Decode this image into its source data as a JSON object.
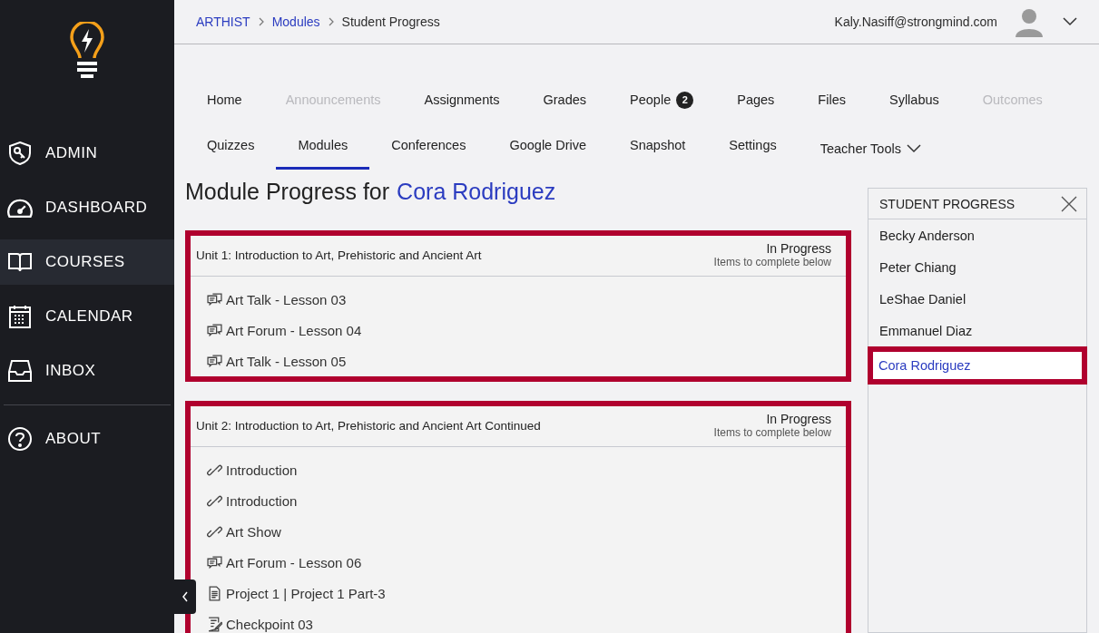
{
  "sidebar": {
    "items": [
      {
        "label": "ADMIN",
        "kind": "admin",
        "selected": false
      },
      {
        "label": "DASHBOARD",
        "kind": "dashboard",
        "selected": false
      },
      {
        "label": "COURSES",
        "kind": "courses",
        "selected": true
      },
      {
        "label": "CALENDAR",
        "kind": "calendar",
        "selected": false
      },
      {
        "label": "INBOX",
        "kind": "inbox",
        "selected": false
      }
    ],
    "footer_items": [
      {
        "label": "ABOUT",
        "kind": "about",
        "selected": false
      }
    ]
  },
  "breadcrumb": [
    {
      "label": "ARTHIST",
      "kind": "link"
    },
    {
      "label": "Modules",
      "kind": "link"
    },
    {
      "label": "Student Progress",
      "kind": "current"
    }
  ],
  "user": {
    "email": "Kaly.Nasiff@strongmind.com"
  },
  "tabs": [
    [
      {
        "label": "Home",
        "selected": false,
        "disabled": false
      },
      {
        "label": "Announcements",
        "selected": false,
        "disabled": true
      },
      {
        "label": "Assignments",
        "selected": false,
        "disabled": false
      },
      {
        "label": "Grades",
        "selected": false,
        "disabled": false
      },
      {
        "label": "People",
        "selected": false,
        "disabled": false,
        "badge": "2"
      },
      {
        "label": "Pages",
        "selected": false,
        "disabled": false
      },
      {
        "label": "Files",
        "selected": false,
        "disabled": false
      },
      {
        "label": "Syllabus",
        "selected": false,
        "disabled": false
      },
      {
        "label": "Outcomes",
        "selected": false,
        "disabled": true
      }
    ],
    [
      {
        "label": "Quizzes",
        "selected": false,
        "disabled": false
      },
      {
        "label": "Modules",
        "selected": true,
        "disabled": false
      },
      {
        "label": "Conferences",
        "selected": false,
        "disabled": false
      },
      {
        "label": "Google Drive",
        "selected": false,
        "disabled": false
      },
      {
        "label": "Snapshot",
        "selected": false,
        "disabled": false
      },
      {
        "label": "Settings",
        "selected": false,
        "disabled": false
      },
      {
        "label": "Teacher Tools",
        "selected": false,
        "disabled": false,
        "kind": "dropdown"
      }
    ]
  ],
  "page_title": {
    "prefix": "Module Progress for",
    "student": "Cora Rodriguez"
  },
  "modules": [
    {
      "title": "Unit 1: Introduction to Art, Prehistoric and Ancient Art",
      "status": "In Progress",
      "status_note": "Items to complete below",
      "highlighted": true,
      "items": [
        {
          "label": "Art Talk - Lesson 03",
          "kind": "discussion"
        },
        {
          "label": "Art Forum - Lesson 04",
          "kind": "discussion"
        },
        {
          "label": "Art Talk - Lesson 05",
          "kind": "discussion"
        }
      ]
    },
    {
      "title": "Unit 2: Introduction to Art, Prehistoric and Ancient Art Continued",
      "status": "In Progress",
      "status_note": "Items to complete below",
      "highlighted": true,
      "items": [
        {
          "label": "Introduction",
          "kind": "link"
        },
        {
          "label": "Introduction",
          "kind": "link"
        },
        {
          "label": "Art Show",
          "kind": "link"
        },
        {
          "label": "Art Forum - Lesson 06",
          "kind": "discussion"
        },
        {
          "label": "Project 1 | Project 1 Part-3",
          "kind": "page"
        },
        {
          "label": "Checkpoint 03",
          "kind": "quiz"
        }
      ]
    }
  ],
  "student_panel": {
    "title": "STUDENT PROGRESS",
    "students": [
      {
        "name": "Becky Anderson",
        "selected": false
      },
      {
        "name": "Peter Chiang",
        "selected": false
      },
      {
        "name": "LeShae Daniel",
        "selected": false
      },
      {
        "name": "Emmanuel Diaz",
        "selected": false
      },
      {
        "name": "Cora Rodriguez",
        "selected": true
      }
    ]
  }
}
